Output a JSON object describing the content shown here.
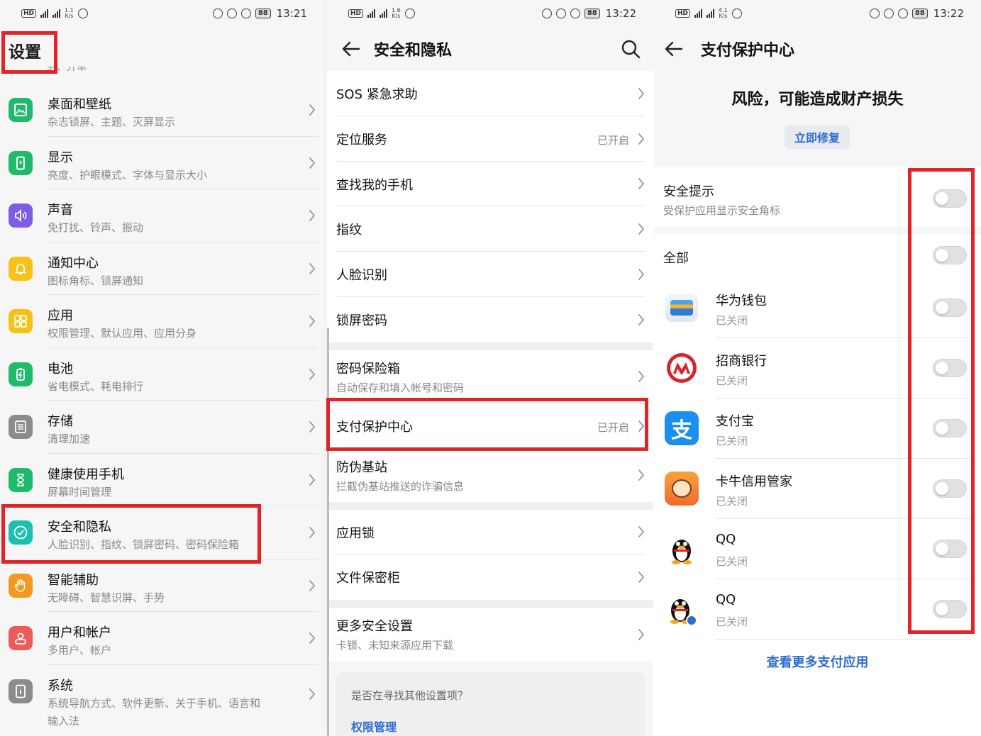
{
  "status_bars": [
    {
      "speed_top": "1.1",
      "speed_unit": "K/s",
      "battery": "88",
      "time": "13:21"
    },
    {
      "speed_top": "1.6",
      "speed_unit": "K/s",
      "battery": "88",
      "time": "13:22"
    },
    {
      "speed_top": "4.1",
      "speed_unit": "K/s",
      "battery": "88",
      "time": "13:22"
    }
  ],
  "settings": {
    "title": "设置",
    "cut_text": "另、开单",
    "items": [
      {
        "title": "桌面和壁纸",
        "subtitle": "杂志锁屏、主题、灭屏显示",
        "icon": "wallpaper-icon",
        "color": "#1fbb6b"
      },
      {
        "title": "显示",
        "subtitle": "亮度、护眼模式、字体与显示大小",
        "icon": "display-icon",
        "color": "#1fbb6b"
      },
      {
        "title": "声音",
        "subtitle": "免打扰、铃声、振动",
        "icon": "sound-icon",
        "color": "#7d5ce8"
      },
      {
        "title": "通知中心",
        "subtitle": "图标角标、锁屏通知",
        "icon": "bell-icon",
        "color": "#f7c218"
      },
      {
        "title": "应用",
        "subtitle": "权限管理、默认应用、应用分身",
        "icon": "apps-grid-icon",
        "color": "#f7c218"
      },
      {
        "title": "电池",
        "subtitle": "省电模式、耗电排行",
        "icon": "battery-icon",
        "color": "#1fbb6b"
      },
      {
        "title": "存储",
        "subtitle": "清理加速",
        "icon": "storage-icon",
        "color": "#8c8c8c"
      },
      {
        "title": "健康使用手机",
        "subtitle": "屏幕时间管理",
        "icon": "hourglass-icon",
        "color": "#1fbb6b"
      },
      {
        "title": "安全和隐私",
        "subtitle": "人脸识别、指纹、锁屏密码、密码保险箱",
        "icon": "shield-check-icon",
        "color": "#1cbfb0"
      },
      {
        "title": "智能辅助",
        "subtitle": "无障碍、智慧识屏、手势",
        "icon": "hand-icon",
        "color": "#f29a1f"
      },
      {
        "title": "用户和帐户",
        "subtitle": "多用户、帐户",
        "icon": "user-icon",
        "color": "#ec5b5b"
      },
      {
        "title": "系统",
        "subtitle": "系统导航方式、软件更新、关于手机、语言和",
        "subtitle2": "输入法",
        "icon": "system-info-icon",
        "color": "#8c8c8c"
      }
    ]
  },
  "security": {
    "title": "安全和隐私",
    "items": [
      {
        "title": "SOS 紧急求助"
      },
      {
        "title": "定位服务",
        "value": "已开启"
      },
      {
        "title": "查找我的手机"
      },
      {
        "title": "指纹"
      },
      {
        "title": "人脸识别"
      },
      {
        "title": "锁屏密码"
      },
      {
        "title": "密码保险箱",
        "subtitle": "自动保存和填入帐号和密码"
      },
      {
        "title": "支付保护中心",
        "value": "已开启"
      },
      {
        "title": "防伪基站",
        "subtitle": "拦截伪基站推送的诈骗信息"
      },
      {
        "title": "应用锁"
      },
      {
        "title": "文件保密柜"
      },
      {
        "title": "更多安全设置",
        "subtitle": "卡锁、未知来源应用下载"
      }
    ],
    "suggest_question": "是否在寻找其他设置项？",
    "suggest_link": "权限管理"
  },
  "payment": {
    "title": "支付保护中心",
    "risk_text": "风险，可能造成财产损失",
    "fix_button": "立即修复",
    "safety_tip_title": "安全提示",
    "safety_tip_subtitle": "受保护应用显示安全角标",
    "all_label": "全部",
    "apps": [
      {
        "name": "华为钱包",
        "state": "已关闭",
        "icon": "huawei-wallet-icon"
      },
      {
        "name": "招商银行",
        "state": "已关闭",
        "icon": "cmb-bank-icon"
      },
      {
        "name": "支付宝",
        "state": "已关闭",
        "icon": "alipay-icon"
      },
      {
        "name": "卡牛信用管家",
        "state": "已关闭",
        "icon": "kaniu-icon"
      },
      {
        "name": "QQ",
        "state": "已关闭",
        "icon": "qq-icon"
      },
      {
        "name": "QQ",
        "state": "已关闭",
        "icon": "qq-clone-icon"
      }
    ],
    "more_link": "查看更多支付应用",
    "accent": "#2d6dd1",
    "highlight": "#e0242a"
  }
}
